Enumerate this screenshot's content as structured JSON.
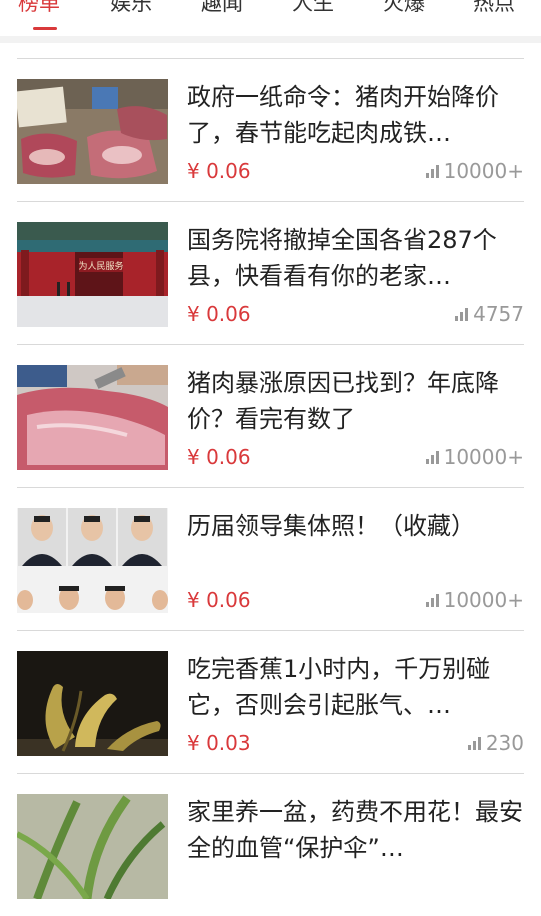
{
  "tabs": [
    "榜单",
    "娱乐",
    "趣闻",
    "人生",
    "火爆",
    "热点"
  ],
  "active_tab": "榜单",
  "articles": [
    {
      "title": "政府一纸命令：猪肉开始降价了，春节能吃起肉成铁…",
      "price": "¥ 0.06",
      "views": "10000+"
    },
    {
      "title": "国务院将撤掉全国各省287个县，快看看有你的老家…",
      "price": "¥ 0.06",
      "views": "4757"
    },
    {
      "title": "猪肉暴涨原因已找到？年底降价？看完有数了",
      "price": "¥ 0.06",
      "views": "10000+"
    },
    {
      "title": "历届领导集体照！（收藏）",
      "price": "¥ 0.06",
      "views": "10000+"
    },
    {
      "title": "吃完香蕉1小时内，千万别碰它，否则会引起胀气、…",
      "price": "¥ 0.03",
      "views": "230"
    },
    {
      "title": "家里养一盆，药费不用花！最安全的血管“保护伞”…",
      "price": "",
      "views": ""
    }
  ],
  "thumbnail_sign_text": "为人民服务",
  "colors": {
    "accent": "#d9393b",
    "text": "#222222",
    "muted": "#999999",
    "divider": "#d9d9d9"
  },
  "icons": {
    "views": "bar-chart-icon"
  }
}
